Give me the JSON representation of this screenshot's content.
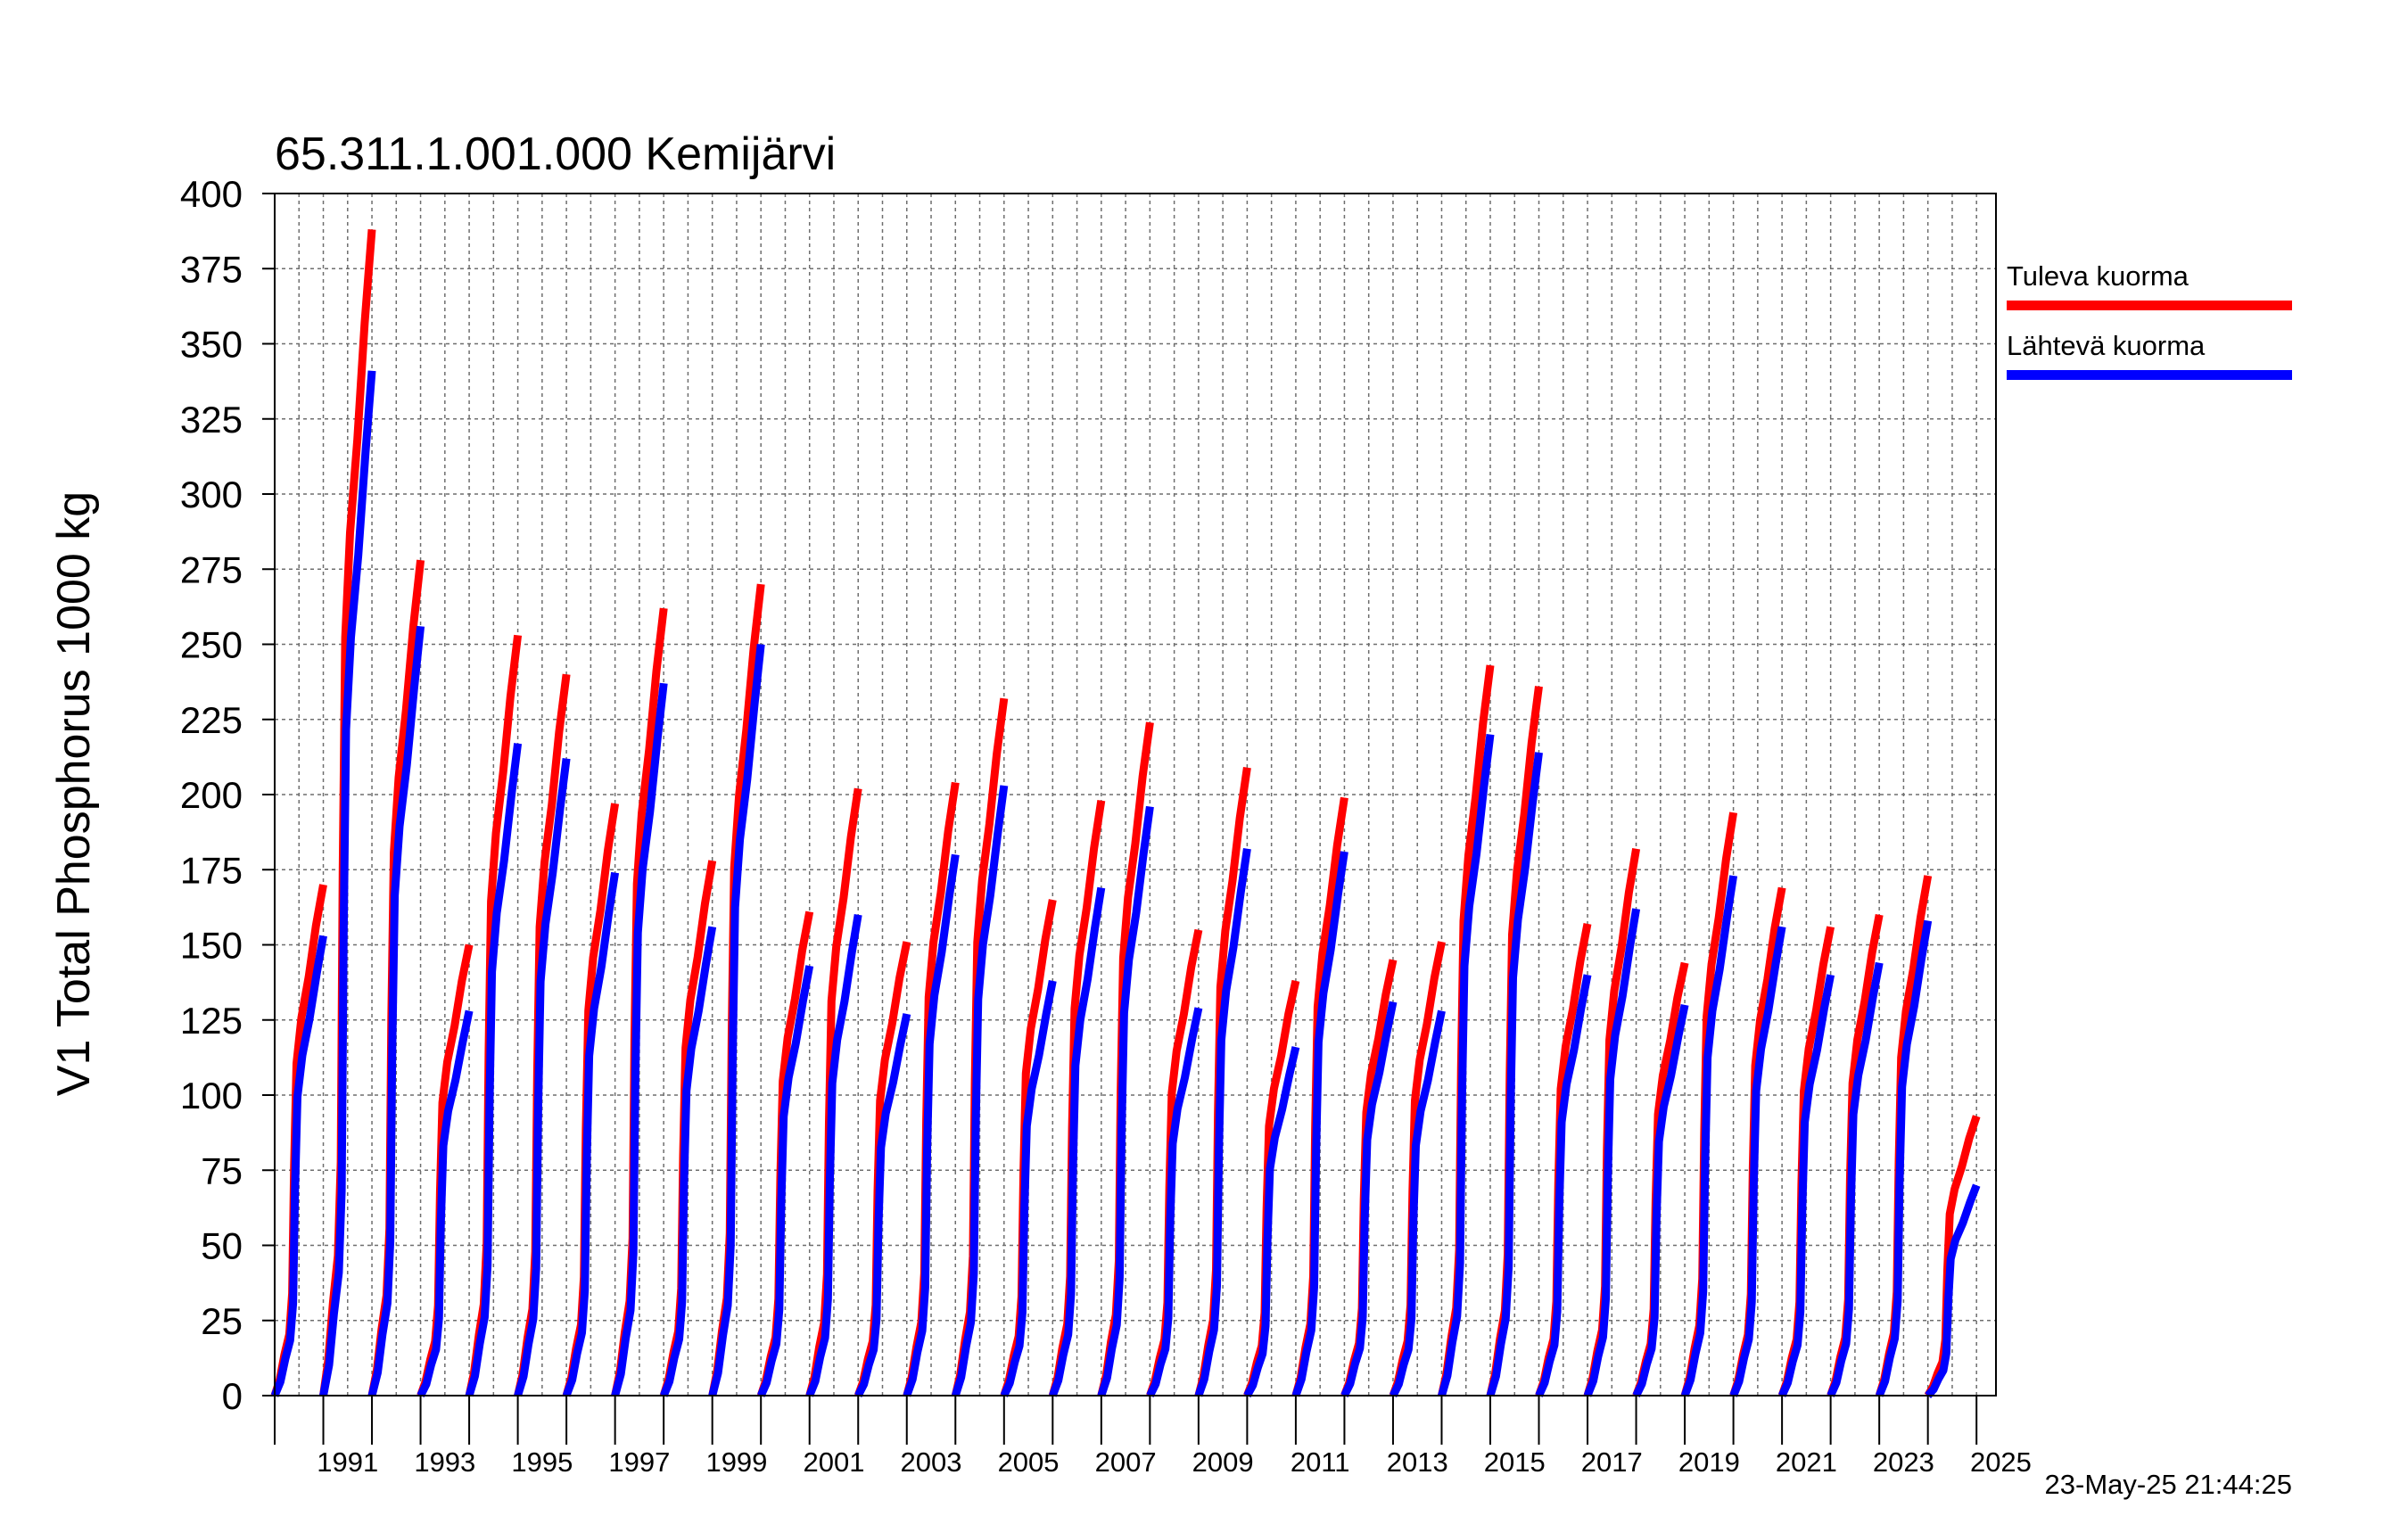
{
  "chart_data": {
    "type": "line",
    "title": "65.311.1.001.000 Kemijärvi",
    "ylabel": "V1 Total Phosphorus 1000 kg",
    "xlabel": "",
    "ylim": [
      0,
      400
    ],
    "yticks": [
      0,
      25,
      50,
      75,
      100,
      125,
      150,
      175,
      200,
      225,
      250,
      275,
      300,
      325,
      350,
      375,
      400
    ],
    "xlim": [
      1990,
      2025.4
    ],
    "xticks": [
      "1991",
      "1993",
      "1995",
      "1997",
      "1999",
      "2001",
      "2003",
      "2005",
      "2007",
      "2009",
      "2011",
      "2013",
      "2015",
      "2017",
      "2019",
      "2021",
      "2023",
      "2025"
    ],
    "grid": true,
    "legend_position": "right",
    "timestamp": "23-May-25 21:44:25",
    "series": [
      {
        "name": "Tuleva kuorma",
        "color": "#ff0000",
        "annual_totals": [
          170,
          388,
          278,
          150,
          253,
          240,
          197,
          262,
          178,
          270,
          161,
          202,
          151,
          204,
          232,
          165,
          198,
          224,
          155,
          209,
          138,
          199,
          145,
          151,
          243,
          236,
          157,
          182,
          144,
          194,
          169,
          156,
          160,
          173,
          93
        ]
      },
      {
        "name": "Lähtevä kuorma",
        "color": "#0000ff",
        "annual_totals": [
          153,
          341,
          256,
          128,
          217,
          212,
          174,
          237,
          156,
          250,
          143,
          160,
          127,
          180,
          203,
          138,
          169,
          196,
          129,
          182,
          116,
          181,
          131,
          128,
          220,
          214,
          140,
          162,
          130,
          173,
          156,
          140,
          144,
          158,
          70
        ]
      }
    ]
  }
}
